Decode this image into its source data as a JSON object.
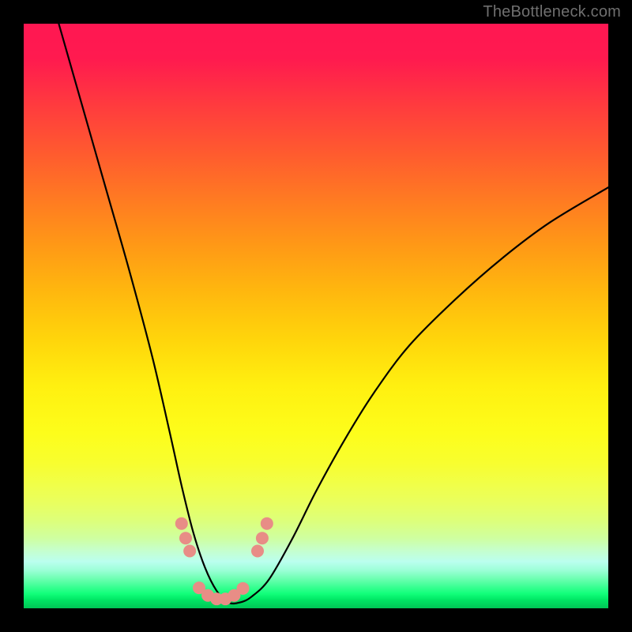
{
  "watermark": "TheBottleneck.com",
  "colors": {
    "frame": "#000000",
    "curve": "#000000",
    "marker": "#e88d86",
    "gradient_top": "#ff1752",
    "gradient_bottom": "#00c556"
  },
  "chart_data": {
    "type": "line",
    "title": "",
    "xlabel": "",
    "ylabel": "",
    "xlim": [
      0,
      100
    ],
    "ylim": [
      0,
      100
    ],
    "grid": false,
    "legend": false,
    "series": [
      {
        "name": "bottleneck-curve",
        "x": [
          6,
          10,
          14,
          18,
          22,
          25,
          27,
          29,
          31,
          33,
          35,
          37,
          39,
          42,
          46,
          50,
          55,
          60,
          66,
          74,
          82,
          90,
          100
        ],
        "y": [
          100,
          86,
          72,
          58,
          43,
          30,
          21,
          13,
          7,
          3,
          1,
          1,
          2,
          5,
          12,
          20,
          29,
          37,
          45,
          53,
          60,
          66,
          72
        ]
      }
    ],
    "markers": [
      {
        "x": 27.0,
        "y": 14.5
      },
      {
        "x": 27.7,
        "y": 12.0
      },
      {
        "x": 28.4,
        "y": 9.8
      },
      {
        "x": 30.0,
        "y": 3.5
      },
      {
        "x": 31.5,
        "y": 2.2
      },
      {
        "x": 33.0,
        "y": 1.6
      },
      {
        "x": 34.5,
        "y": 1.6
      },
      {
        "x": 36.0,
        "y": 2.2
      },
      {
        "x": 37.5,
        "y": 3.4
      },
      {
        "x": 40.0,
        "y": 9.8
      },
      {
        "x": 40.8,
        "y": 12.0
      },
      {
        "x": 41.6,
        "y": 14.5
      }
    ],
    "marker_radius_px": 8
  }
}
